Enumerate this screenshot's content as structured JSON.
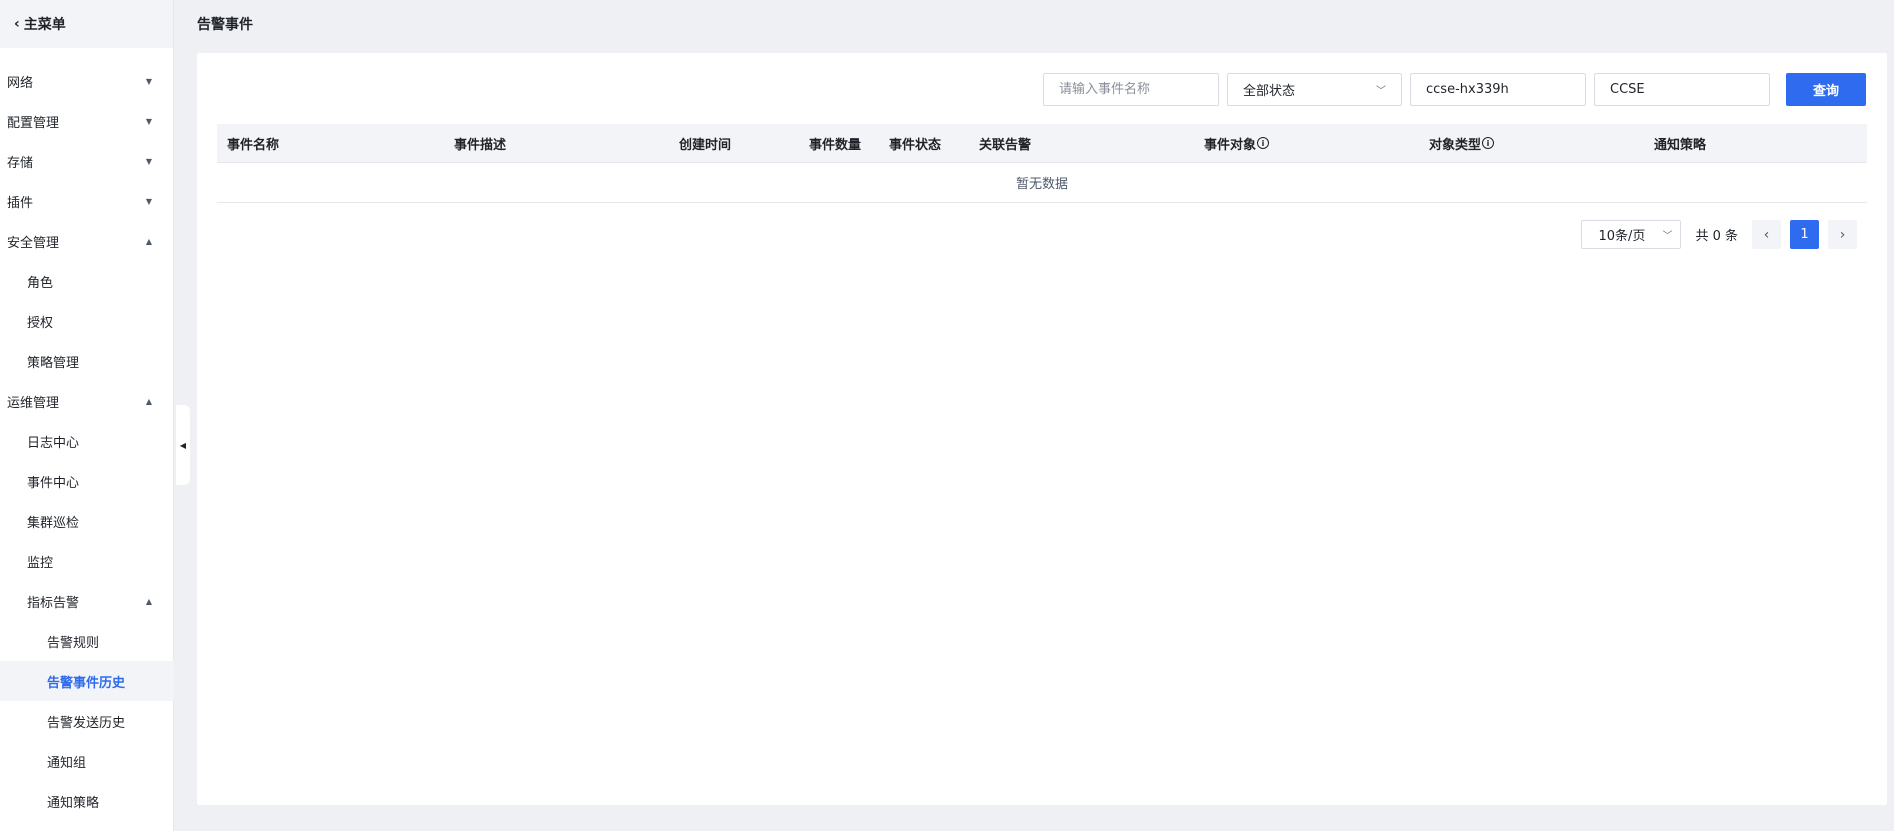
{
  "sidebar": {
    "back_label": "主菜单",
    "items": [
      {
        "label": "网络",
        "caret": "▼"
      },
      {
        "label": "配置管理",
        "caret": "▼"
      },
      {
        "label": "存储",
        "caret": "▼"
      },
      {
        "label": "插件",
        "caret": "▼"
      },
      {
        "label": "安全管理",
        "caret": "▲"
      },
      {
        "label": "角色"
      },
      {
        "label": "授权"
      },
      {
        "label": "策略管理"
      },
      {
        "label": "运维管理",
        "caret": "▲"
      },
      {
        "label": "日志中心"
      },
      {
        "label": "事件中心"
      },
      {
        "label": "集群巡检"
      },
      {
        "label": "监控"
      },
      {
        "label": "指标告警",
        "caret": "▲"
      },
      {
        "label": "告警规则"
      },
      {
        "label": "告警事件历史"
      },
      {
        "label": "告警发送历史"
      },
      {
        "label": "通知组"
      },
      {
        "label": "通知策略"
      }
    ]
  },
  "page": {
    "title": "告警事件"
  },
  "filters": {
    "event_name_placeholder": "请输入事件名称",
    "status_value": "全部状态",
    "cluster_value": "ccse-hx339h",
    "type_value": "CCSE",
    "query_label": "查询"
  },
  "table": {
    "columns": [
      "事件名称",
      "事件描述",
      "创建时间",
      "事件数量",
      "事件状态",
      "关联告警",
      "事件对象",
      "对象类型",
      "通知策略"
    ],
    "empty_text": "暂无数据"
  },
  "pagination": {
    "page_size": "10条/页",
    "total_text": "共 0 条",
    "current_page": "1"
  },
  "colors": {
    "accent": "#2f6bee",
    "background": "#eef0f4"
  }
}
